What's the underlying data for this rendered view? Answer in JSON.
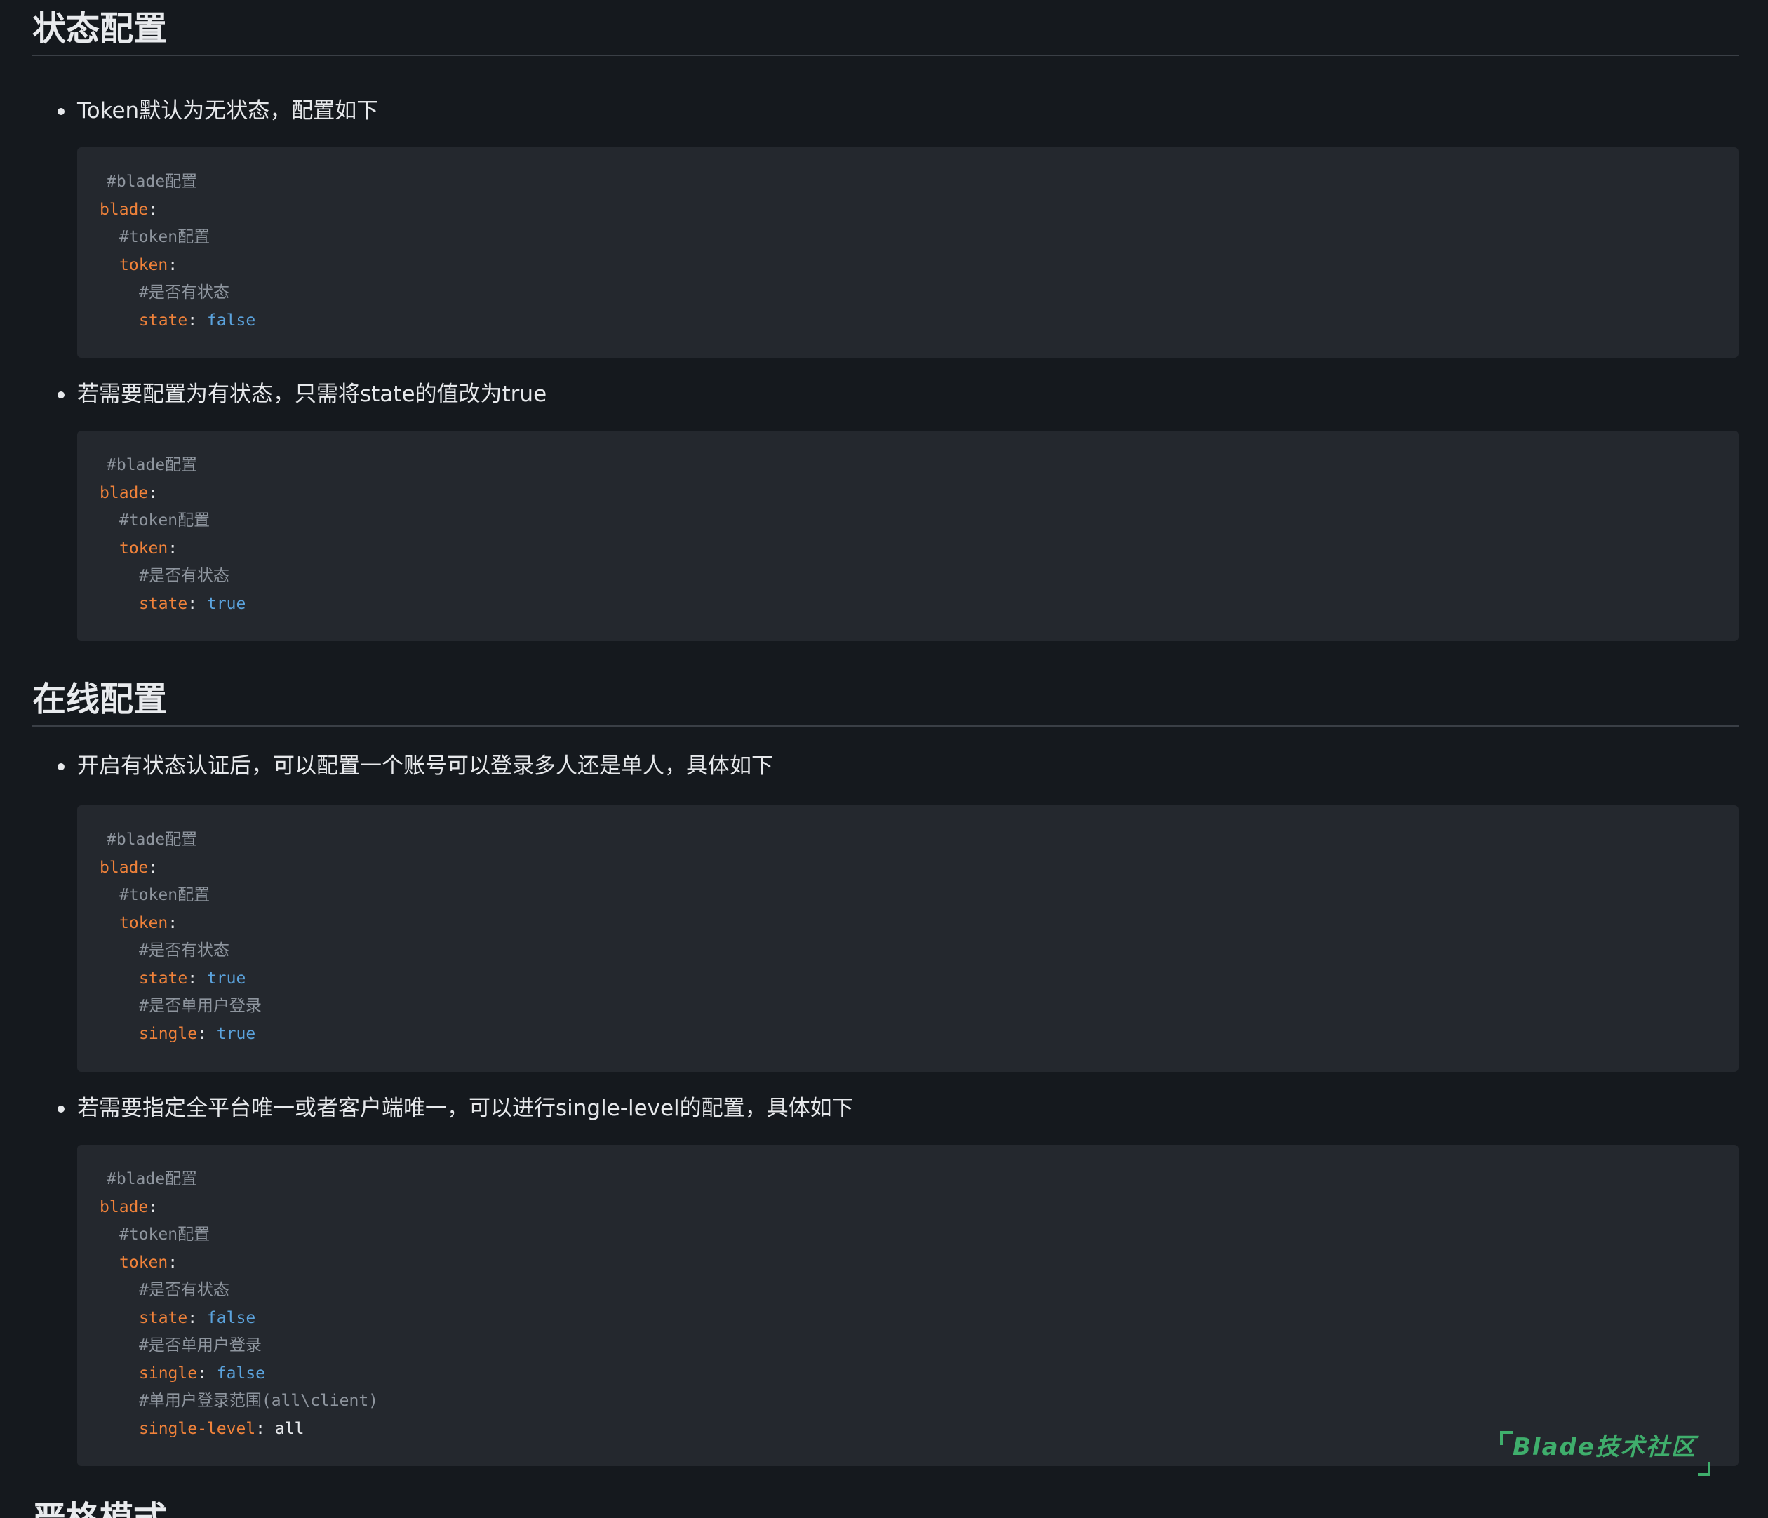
{
  "sections": [
    {
      "title": "状态配置",
      "items": [
        {
          "text": "Token默认为无状态，配置如下",
          "code": {
            "c1": "#blade配置",
            "k1": "blade",
            "c2": "#token配置",
            "k2": "token",
            "c3": "#是否有状态",
            "k3": "state",
            "v3": "false"
          }
        },
        {
          "text": "若需要配置为有状态，只需将state的值改为true",
          "code": {
            "c1": "#blade配置",
            "k1": "blade",
            "c2": "#token配置",
            "k2": "token",
            "c3": "#是否有状态",
            "k3": "state",
            "v3": "true"
          }
        }
      ]
    },
    {
      "title": "在线配置",
      "items": [
        {
          "text": "开启有状态认证后，可以配置一个账号可以登录多人还是单人，具体如下",
          "code": {
            "c1": "#blade配置",
            "k1": "blade",
            "c2": "#token配置",
            "k2": "token",
            "c3": "#是否有状态",
            "k3": "state",
            "v3": "true",
            "c4": "#是否单用户登录",
            "k4": "single",
            "v4": "true"
          }
        },
        {
          "text": "若需要指定全平台唯一或者客户端唯一，可以进行single-level的配置，具体如下",
          "code": {
            "c1": "#blade配置",
            "k1": "blade",
            "c2": "#token配置",
            "k2": "token",
            "c3": "#是否有状态",
            "k3": "state",
            "v3": "false",
            "c4": "#是否单用户登录",
            "k4": "single",
            "v4": "false",
            "c5": "#单用户登录范围(all\\client)",
            "k5": "single-level",
            "v5": "all"
          }
        }
      ]
    },
    {
      "title": "严格模式"
    }
  ],
  "watermark": "Blade技术社区",
  "colors": {
    "background": "#15191e",
    "code_background": "#24282e",
    "key": "#f0823a",
    "comment": "#8e959e",
    "boolean": "#5ba3dd",
    "watermark": "#3fae6c"
  }
}
